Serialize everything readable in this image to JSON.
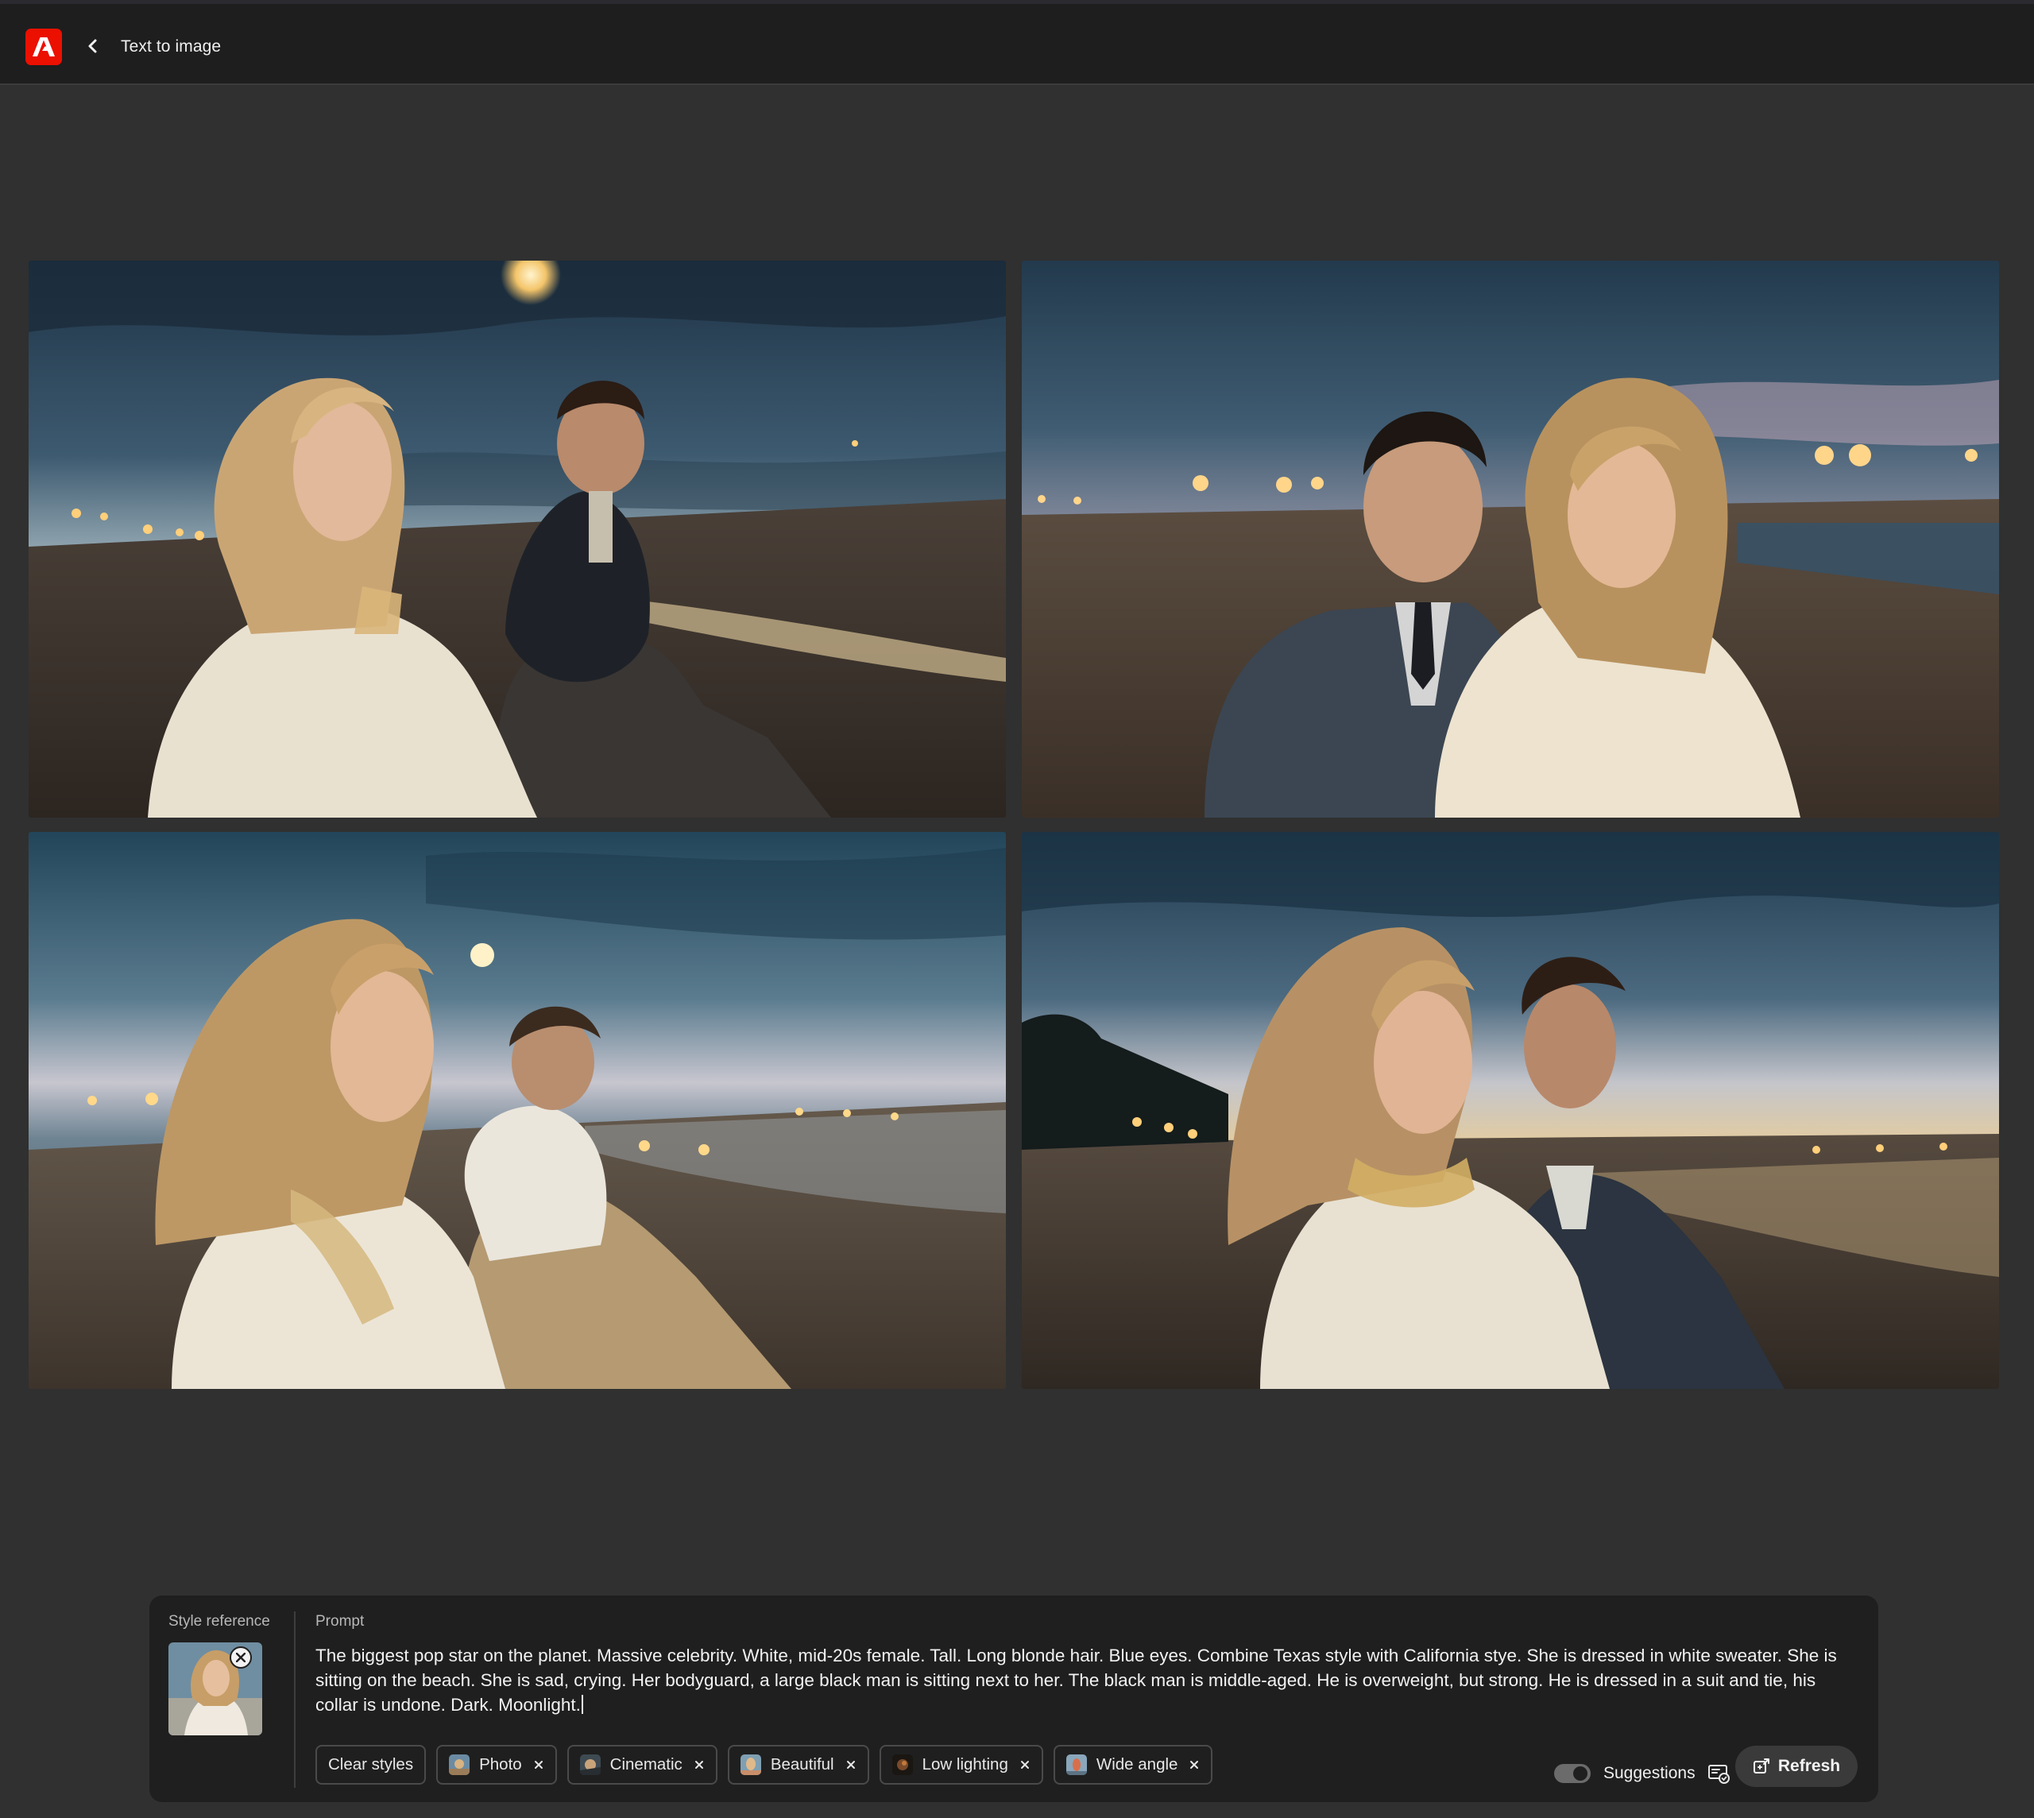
{
  "header": {
    "title": "Text to image",
    "logo_icon": "adobe-logo",
    "back_icon": "chevron-left-icon"
  },
  "results": {
    "images": [
      {
        "alt": "Generated image 1"
      },
      {
        "alt": "Generated image 2"
      },
      {
        "alt": "Generated image 3"
      },
      {
        "alt": "Generated image 4"
      }
    ]
  },
  "panel": {
    "style_reference_label": "Style reference",
    "prompt_label": "Prompt",
    "prompt_lines": [
      "The biggest pop star on the planet. Massive celebrity. White, mid-20s female. Tall. Long blonde hair. Blue eyes. Combine Texas style with California stye. She is dressed in white sweater. She is",
      "sitting on the beach. She is sad, crying. Her bodyguard, a large black man is sitting next to her. The black man is middle-aged. He is overweight, but strong. He is dressed in a suit and tie, his",
      "collar is undone. Dark. Moonlight."
    ],
    "clear_styles": "Clear styles",
    "chips": [
      "Photo",
      "Cinematic",
      "Beautiful",
      "Low lighting",
      "Wide angle"
    ],
    "suggestions_label": "Suggestions",
    "refresh_label": "Refresh"
  },
  "colors": {
    "background": "#303030",
    "topbar": "#1e1e1e",
    "panel": "#1f1f1f",
    "adobe_red": "#eb1000"
  }
}
